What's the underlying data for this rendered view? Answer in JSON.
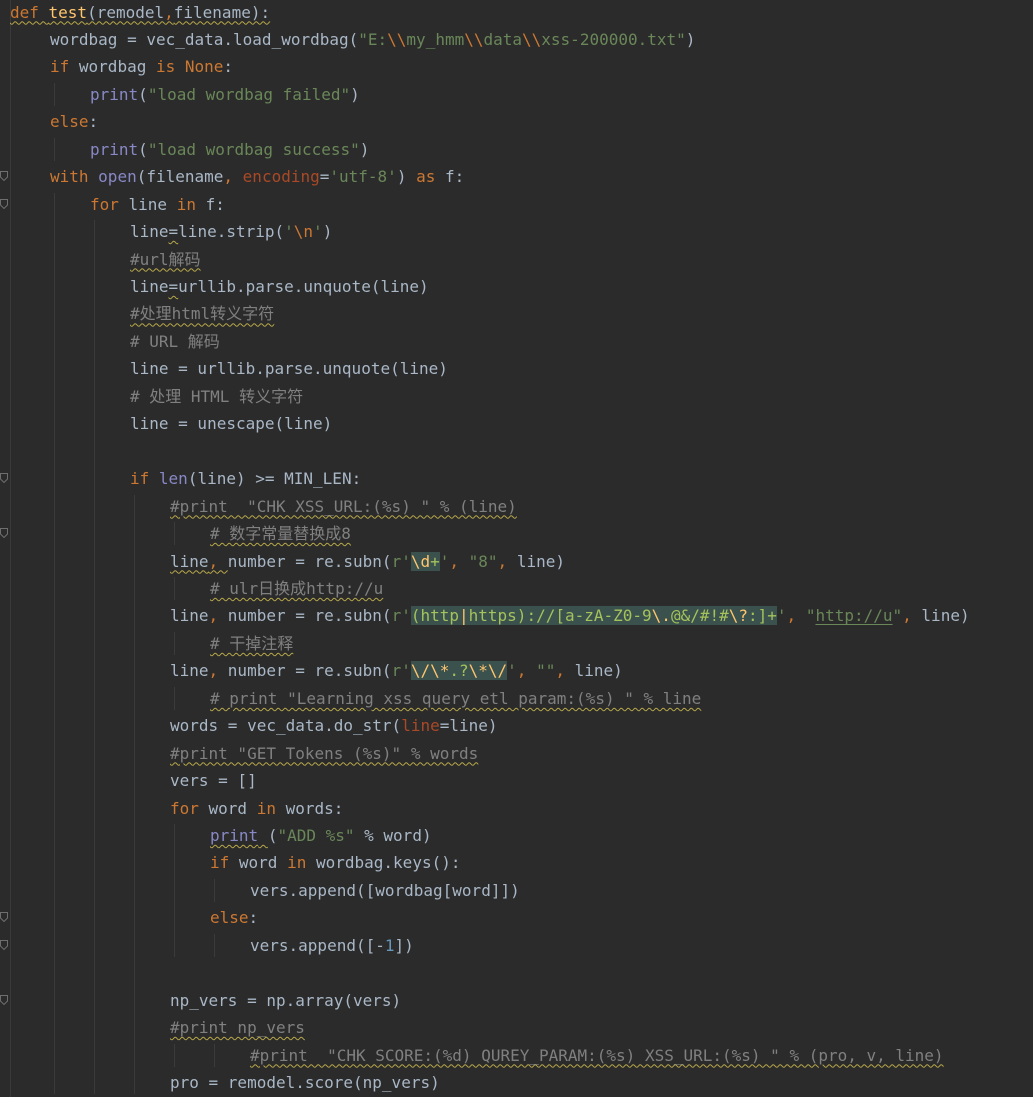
{
  "editor": {
    "colors": {
      "background": "#2b2b2b",
      "default": "#a9b7c6",
      "keyword": "#cc7832",
      "function_def": "#ffc66d",
      "string": "#6a8759",
      "number": "#6897bb",
      "comment": "#808080",
      "builtin": "#8888c6",
      "kwarg": "#aa4926",
      "regex": "#a5c25c",
      "escape": "#cc7832",
      "link": "#287bde",
      "none_kw": "#cc7832"
    },
    "fold_rows": [
      6,
      7,
      17,
      19,
      33,
      34,
      36
    ],
    "lines": [
      {
        "indent": 0,
        "tokens": [
          {
            "t": "def ",
            "c": "keyword",
            "u": "squig"
          },
          {
            "t": "test",
            "c": "function_def",
            "u": "squig"
          },
          {
            "t": "(remodel",
            "c": "default",
            "u": "squig"
          },
          {
            "t": ",",
            "c": "keyword",
            "u": "squig"
          },
          {
            "t": "filename):",
            "c": "default",
            "u": "squig"
          }
        ]
      },
      {
        "indent": 1,
        "tokens": [
          {
            "t": "wordbag = vec_data.load_wordbag(",
            "c": "default"
          },
          {
            "t": "\"E:",
            "c": "string"
          },
          {
            "t": "\\\\",
            "c": "escape"
          },
          {
            "t": "my_hmm",
            "c": "string"
          },
          {
            "t": "\\\\",
            "c": "escape"
          },
          {
            "t": "data",
            "c": "string"
          },
          {
            "t": "\\\\",
            "c": "escape"
          },
          {
            "t": "xss-200000.txt\"",
            "c": "string"
          },
          {
            "t": ")",
            "c": "default"
          }
        ]
      },
      {
        "indent": 1,
        "tokens": [
          {
            "t": "if ",
            "c": "keyword"
          },
          {
            "t": "wordbag ",
            "c": "default"
          },
          {
            "t": "is ",
            "c": "keyword"
          },
          {
            "t": "None",
            "c": "none_kw"
          },
          {
            "t": ":",
            "c": "default"
          }
        ]
      },
      {
        "indent": 2,
        "tokens": [
          {
            "t": "print",
            "c": "builtin"
          },
          {
            "t": "(",
            "c": "default"
          },
          {
            "t": "\"load wordbag failed\"",
            "c": "string"
          },
          {
            "t": ")",
            "c": "default"
          }
        ]
      },
      {
        "indent": 1,
        "tokens": [
          {
            "t": "else",
            "c": "keyword"
          },
          {
            "t": ":",
            "c": "default"
          }
        ]
      },
      {
        "indent": 2,
        "tokens": [
          {
            "t": "print",
            "c": "builtin"
          },
          {
            "t": "(",
            "c": "default"
          },
          {
            "t": "\"load wordbag success\"",
            "c": "string"
          },
          {
            "t": ")",
            "c": "default"
          }
        ]
      },
      {
        "indent": 1,
        "tokens": [
          {
            "t": "with ",
            "c": "keyword"
          },
          {
            "t": "open",
            "c": "builtin"
          },
          {
            "t": "(filename",
            "c": "default"
          },
          {
            "t": ", ",
            "c": "keyword"
          },
          {
            "t": "encoding",
            "c": "kwarg"
          },
          {
            "t": "=",
            "c": "default"
          },
          {
            "t": "'utf-8'",
            "c": "string"
          },
          {
            "t": ") ",
            "c": "default"
          },
          {
            "t": "as ",
            "c": "keyword"
          },
          {
            "t": "f:",
            "c": "default"
          }
        ]
      },
      {
        "indent": 2,
        "tokens": [
          {
            "t": "for ",
            "c": "keyword"
          },
          {
            "t": "line ",
            "c": "default"
          },
          {
            "t": "in ",
            "c": "keyword"
          },
          {
            "t": "f:",
            "c": "default"
          }
        ]
      },
      {
        "indent": 3,
        "tokens": [
          {
            "t": "line",
            "c": "default"
          },
          {
            "t": "=",
            "c": "default",
            "u": "squig"
          },
          {
            "t": "line.strip(",
            "c": "default"
          },
          {
            "t": "'",
            "c": "string"
          },
          {
            "t": "\\n",
            "c": "escape"
          },
          {
            "t": "'",
            "c": "string"
          },
          {
            "t": ")",
            "c": "default"
          }
        ]
      },
      {
        "indent": 3,
        "tokens": [
          {
            "t": "#url解码",
            "c": "comment",
            "u": "squig"
          }
        ]
      },
      {
        "indent": 3,
        "tokens": [
          {
            "t": "line",
            "c": "default"
          },
          {
            "t": "=",
            "c": "default",
            "u": "squig"
          },
          {
            "t": "urllib.parse.unquote(line)",
            "c": "default"
          }
        ]
      },
      {
        "indent": 3,
        "tokens": [
          {
            "t": "#处理html转义字符",
            "c": "comment",
            "u": "squig"
          }
        ]
      },
      {
        "indent": 3,
        "tokens": [
          {
            "t": "# URL 解码",
            "c": "comment"
          }
        ]
      },
      {
        "indent": 3,
        "tokens": [
          {
            "t": "line = urllib.parse.unquote(line)",
            "c": "default"
          }
        ]
      },
      {
        "indent": 3,
        "tokens": [
          {
            "t": "# 处理 HTML 转义字符",
            "c": "comment"
          }
        ]
      },
      {
        "indent": 3,
        "tokens": [
          {
            "t": "line = unescape(line)",
            "c": "default"
          }
        ]
      },
      {
        "indent": 0,
        "tokens": []
      },
      {
        "indent": 3,
        "tokens": [
          {
            "t": "if ",
            "c": "keyword"
          },
          {
            "t": "len",
            "c": "builtin"
          },
          {
            "t": "(line) >= MIN_LEN:",
            "c": "default"
          }
        ]
      },
      {
        "indent": 4,
        "tokens": [
          {
            "t": "#print  \"CHK XSS_URL:(%s) \" % (line)",
            "c": "comment",
            "u": "squig"
          }
        ]
      },
      {
        "indent": 5,
        "tokens": [
          {
            "t": "# 数字常量替换成8",
            "c": "comment",
            "u": "squig"
          }
        ]
      },
      {
        "indent": 4,
        "tokens": [
          {
            "t": "line",
            "c": "default",
            "u": "squig"
          },
          {
            "t": ", ",
            "c": "keyword",
            "u": "squig"
          },
          {
            "t": "number = re.subn(",
            "c": "default"
          },
          {
            "t": "r'",
            "c": "string"
          },
          {
            "t": "\\d",
            "c": "function_def",
            "h": true
          },
          {
            "t": "+",
            "c": "regex",
            "h": true
          },
          {
            "t": "'",
            "c": "string"
          },
          {
            "t": ", ",
            "c": "keyword"
          },
          {
            "t": "\"8\"",
            "c": "string"
          },
          {
            "t": ", ",
            "c": "keyword"
          },
          {
            "t": "line)",
            "c": "default"
          }
        ]
      },
      {
        "indent": 5,
        "tokens": [
          {
            "t": "# ulr日换成http://u",
            "c": "comment",
            "u": "squig"
          }
        ]
      },
      {
        "indent": 4,
        "tokens": [
          {
            "t": "line",
            "c": "default"
          },
          {
            "t": ", ",
            "c": "keyword"
          },
          {
            "t": "number = re.subn(",
            "c": "default"
          },
          {
            "t": "r'",
            "c": "string"
          },
          {
            "t": "(http",
            "c": "regex",
            "h": true
          },
          {
            "t": "|",
            "c": "function_def",
            "h": true
          },
          {
            "t": "https)://[a-zA-Z0-9",
            "c": "regex",
            "h": true
          },
          {
            "t": "\\.",
            "c": "function_def",
            "h": true
          },
          {
            "t": "@&/#!#",
            "c": "regex",
            "h": true
          },
          {
            "t": "\\?",
            "c": "function_def",
            "h": true
          },
          {
            "t": ":]+",
            "c": "regex",
            "h": true
          },
          {
            "t": "'",
            "c": "string"
          },
          {
            "t": ", ",
            "c": "keyword"
          },
          {
            "t": "\"",
            "c": "string"
          },
          {
            "t": "http://u",
            "c": "string",
            "u": "underl"
          },
          {
            "t": "\"",
            "c": "string"
          },
          {
            "t": ", ",
            "c": "keyword"
          },
          {
            "t": "line)",
            "c": "default"
          }
        ]
      },
      {
        "indent": 5,
        "tokens": [
          {
            "t": "# 干掉注释",
            "c": "comment",
            "u": "squig"
          }
        ]
      },
      {
        "indent": 4,
        "tokens": [
          {
            "t": "line",
            "c": "default"
          },
          {
            "t": ", ",
            "c": "keyword"
          },
          {
            "t": "number = re.subn(",
            "c": "default"
          },
          {
            "t": "r'",
            "c": "string"
          },
          {
            "t": "\\/",
            "c": "function_def",
            "h": true
          },
          {
            "t": "\\*",
            "c": "function_def",
            "h": true
          },
          {
            "t": ".?",
            "c": "regex",
            "h": true
          },
          {
            "t": "\\*",
            "c": "function_def",
            "h": true
          },
          {
            "t": "\\/",
            "c": "function_def",
            "h": true
          },
          {
            "t": "'",
            "c": "string"
          },
          {
            "t": ", ",
            "c": "keyword"
          },
          {
            "t": "\"\"",
            "c": "string"
          },
          {
            "t": ", ",
            "c": "keyword"
          },
          {
            "t": "line)",
            "c": "default"
          }
        ]
      },
      {
        "indent": 5,
        "tokens": [
          {
            "t": "# print \"Learning xss query etl param:(%s) \" % line",
            "c": "comment",
            "u": "squig"
          }
        ]
      },
      {
        "indent": 4,
        "tokens": [
          {
            "t": "words = vec_data.do_str(",
            "c": "default"
          },
          {
            "t": "line",
            "c": "kwarg"
          },
          {
            "t": "=line)",
            "c": "default"
          }
        ]
      },
      {
        "indent": 4,
        "tokens": [
          {
            "t": "#print \"GET Tokens (%s)\" % words",
            "c": "comment",
            "u": "squig"
          }
        ]
      },
      {
        "indent": 4,
        "tokens": [
          {
            "t": "vers = []",
            "c": "default"
          }
        ]
      },
      {
        "indent": 4,
        "tokens": [
          {
            "t": "for ",
            "c": "keyword"
          },
          {
            "t": "word ",
            "c": "default"
          },
          {
            "t": "in ",
            "c": "keyword"
          },
          {
            "t": "words:",
            "c": "default"
          }
        ]
      },
      {
        "indent": 5,
        "tokens": [
          {
            "t": "print",
            "c": "builtin",
            "u": "squig"
          },
          {
            "t": " ",
            "c": "default",
            "u": "squig"
          },
          {
            "t": "(",
            "c": "default"
          },
          {
            "t": "\"ADD %s\"",
            "c": "string"
          },
          {
            "t": " % word)",
            "c": "default"
          }
        ]
      },
      {
        "indent": 5,
        "tokens": [
          {
            "t": "if ",
            "c": "keyword"
          },
          {
            "t": "word ",
            "c": "default"
          },
          {
            "t": "in ",
            "c": "keyword"
          },
          {
            "t": "wordbag.keys():",
            "c": "default"
          }
        ]
      },
      {
        "indent": 6,
        "tokens": [
          {
            "t": "vers.append([wordbag[word]])",
            "c": "default"
          }
        ]
      },
      {
        "indent": 5,
        "tokens": [
          {
            "t": "else",
            "c": "keyword"
          },
          {
            "t": ":",
            "c": "default"
          }
        ]
      },
      {
        "indent": 6,
        "tokens": [
          {
            "t": "vers.append([-",
            "c": "default"
          },
          {
            "t": "1",
            "c": "number"
          },
          {
            "t": "])",
            "c": "default"
          }
        ]
      },
      {
        "indent": 0,
        "tokens": []
      },
      {
        "indent": 4,
        "tokens": [
          {
            "t": "np_vers = np.array(vers)",
            "c": "default"
          }
        ]
      },
      {
        "indent": 4,
        "tokens": [
          {
            "t": "#print np_vers",
            "c": "comment",
            "u": "squig"
          }
        ]
      },
      {
        "indent": 6,
        "tokens": [
          {
            "t": "#print  \"CHK SCORE:(%d) QUREY_PARAM:(%s) XSS_URL:(%s) \" % (pro, v, line)",
            "c": "comment",
            "u": "squig"
          }
        ]
      },
      {
        "indent": 4,
        "tokens": [
          {
            "t": "pro = remodel.score(np_vers)",
            "c": "default"
          }
        ]
      }
    ]
  }
}
